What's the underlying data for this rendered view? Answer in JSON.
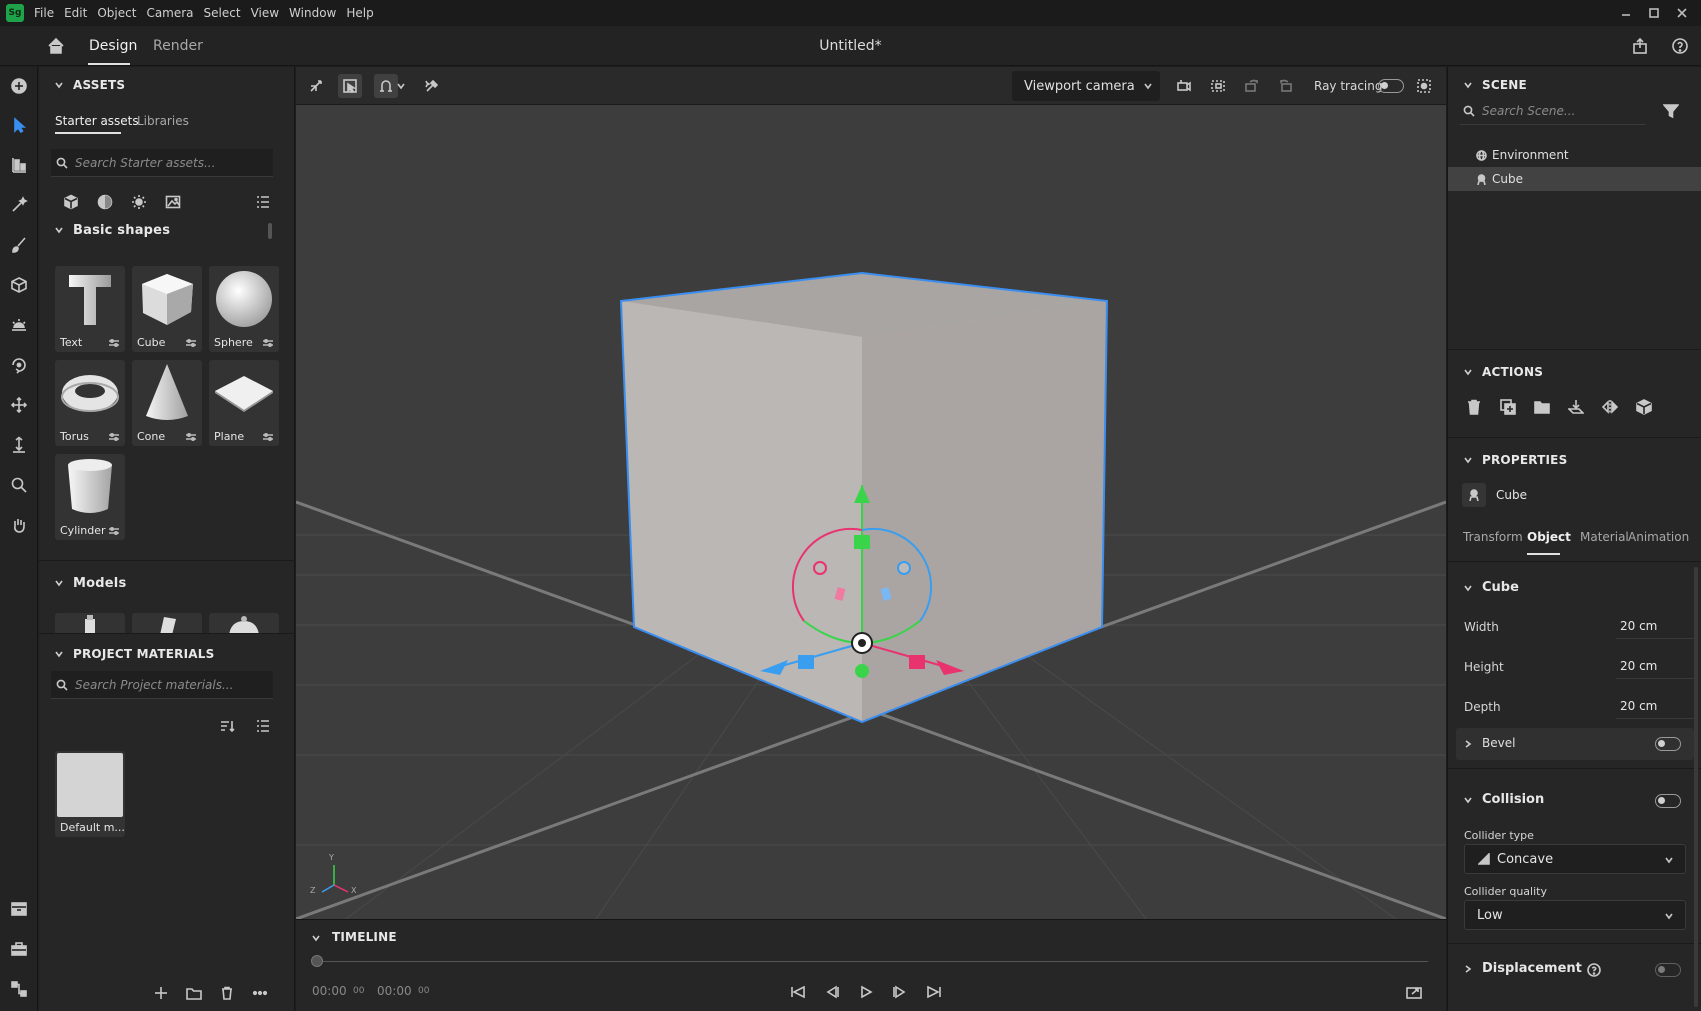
{
  "app": {
    "logo": "Sg",
    "menu": [
      "File",
      "Edit",
      "Object",
      "Camera",
      "Select",
      "View",
      "Window",
      "Help"
    ],
    "document_title": "Untitled*",
    "modes": [
      "Design",
      "Render"
    ]
  },
  "assets": {
    "title": "ASSETS",
    "tabs": [
      "Starter assets",
      "Libraries"
    ],
    "search_placeholder": "Search Starter assets...",
    "basic_shapes_title": "Basic shapes",
    "shapes": [
      "Text",
      "Cube",
      "Sphere",
      "Torus",
      "Cone",
      "Plane",
      "Cylinder"
    ],
    "models_title": "Models",
    "project_materials_title": "PROJECT MATERIALS",
    "materials_search_placeholder": "Search Project materials...",
    "materials": [
      "Default m..."
    ]
  },
  "viewport": {
    "camera": "Viewport camera",
    "ray_tracing_label": "Ray tracing",
    "axis_labels": [
      "Y",
      "Z",
      "X"
    ]
  },
  "timeline": {
    "title": "TIMELINE",
    "current_time": "00:00",
    "current_frames": "00",
    "end_time": "00:00",
    "end_frames": "00"
  },
  "scene": {
    "title": "SCENE",
    "search_placeholder": "Search Scene...",
    "items": [
      "Environment",
      "Cube"
    ]
  },
  "actions": {
    "title": "ACTIONS"
  },
  "properties": {
    "title": "PROPERTIES",
    "object_name": "Cube",
    "tabs": [
      "Transform",
      "Object",
      "Material",
      "Animation"
    ],
    "group_title": "Cube",
    "width_label": "Width",
    "width_value": "20 cm",
    "height_label": "Height",
    "height_value": "20 cm",
    "depth_label": "Depth",
    "depth_value": "20 cm",
    "bevel_label": "Bevel",
    "collision_label": "Collision",
    "collider_type_label": "Collider type",
    "collider_type_value": "Concave",
    "collider_quality_label": "Collider quality",
    "collider_quality_value": "Low",
    "displacement_label": "Displacement"
  },
  "colors": {
    "accent": "#3a8ef0",
    "gizmo_red": "#e8336f",
    "gizmo_green": "#3ad44a",
    "gizmo_blue": "#3a9ef0"
  }
}
